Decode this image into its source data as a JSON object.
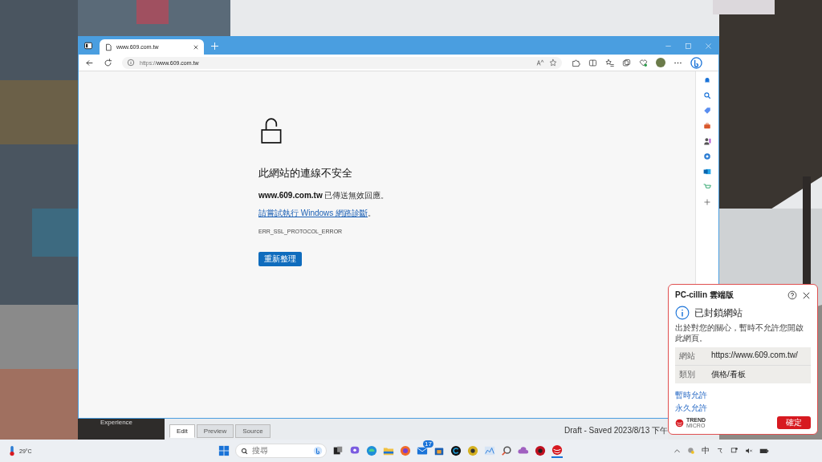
{
  "editor_window": {
    "sidebar_text": "Experience",
    "tabs": [
      {
        "label": "Edit",
        "selected": true
      },
      {
        "label": "Preview",
        "selected": false
      },
      {
        "label": "Source",
        "selected": false
      }
    ],
    "status": "Draft - Saved 2023/8/13 下午"
  },
  "browser": {
    "tab_title": "www.609.com.tw",
    "url_scheme": "https://",
    "url_host": "www.609.com.tw",
    "error": {
      "title": "此網站的連線不安全",
      "message": "**www.609.com.tw** 已傳送無效回應。",
      "link": "請嘗試執行 Windows 網路診斷",
      "link_suffix": "。",
      "code": "ERR_SSL_PROTOCOL_ERROR",
      "button": "重新整理"
    }
  },
  "notification": {
    "app": "PC-cillin 雲端版",
    "title": "已封鎖網站",
    "message": "出於對您的關心，暫時不允許您開啟此網頁。",
    "rows": [
      {
        "label": "網站",
        "value": "https://www.609.com.tw/"
      },
      {
        "label": "類別",
        "value": "價格/看板"
      }
    ],
    "links": [
      "暫時允許",
      "永久允許"
    ],
    "logo": "TREND",
    "logo_sub": "MICRO",
    "button": "確定"
  },
  "taskbar": {
    "weather": "29°C",
    "search_placeholder": "搜尋",
    "mail_badge": "17",
    "ime": "中"
  }
}
